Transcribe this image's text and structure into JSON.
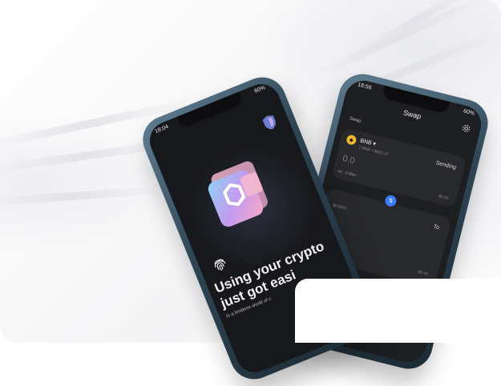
{
  "swap_phone": {
    "status_time": "18:56",
    "status_battery": "60%",
    "title": "Swap",
    "section_label": "Swap",
    "from_token": {
      "symbol": "BNB",
      "price": "1 BNB = $632.47",
      "role": "Sending",
      "amount": "0.0",
      "balance_prefix": "ce : 0",
      "max_label": "Max :",
      "usd_value": "$0.00"
    },
    "swap_icon": "swap-arrows-icon",
    "to_token": {
      "role": "To",
      "usd_small": "$0.0001",
      "usd_value": "$0.00"
    },
    "accent_color": "#3a7bf7",
    "token_color": "#f3ba2f"
  },
  "onboarding_phone": {
    "status_time": "18:04",
    "status_battery": "60%",
    "headline_line1": "Using your crypto",
    "headline_line2": "just got easi",
    "subline": "in a limitless world of c",
    "icons": [
      "wallet-icon",
      "shield-icon",
      "fingerprint-icon"
    ]
  }
}
